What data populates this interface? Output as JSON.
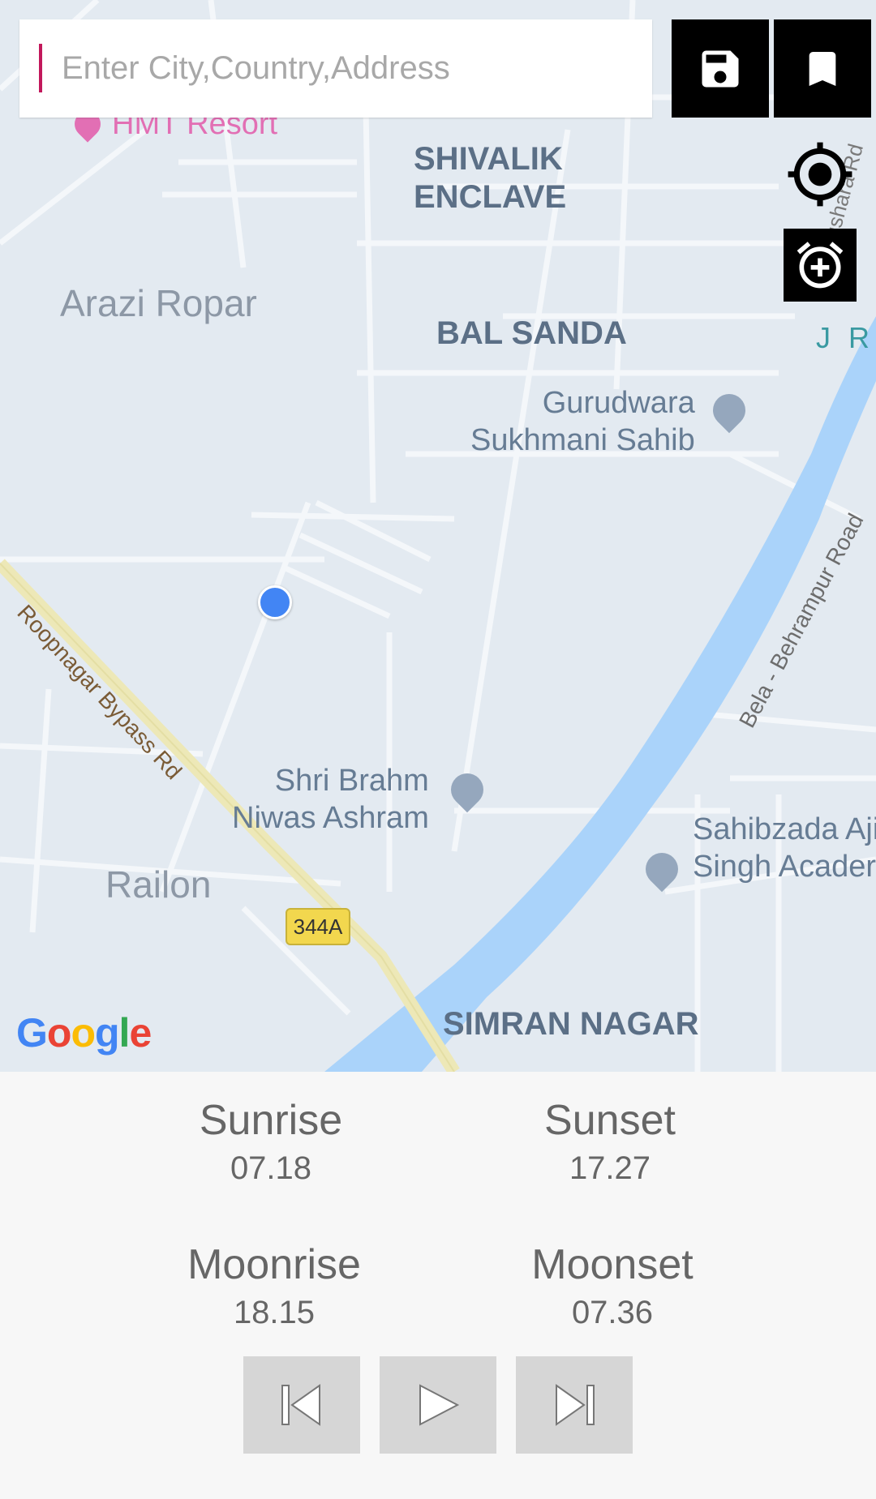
{
  "search": {
    "placeholder": "Enter City,Country,Address",
    "value": ""
  },
  "toolbar": {
    "save_icon": "save-icon",
    "bookmark_icon": "bookmark-icon",
    "locate_icon": "my-location-icon",
    "alarm_icon": "add-alarm-icon"
  },
  "map": {
    "labels": {
      "hmt_resort": "HMT Resort",
      "shivalik_1": "SHIVALIK",
      "shivalik_2": "ENCLAVE",
      "arazi_ropar": "Arazi Ropar",
      "bal_sanda": "BAL SANDA",
      "jr": "J R T",
      "gurudwara_1": "Gurudwara",
      "gurudwara_2": "Sukhmani Sahib",
      "roopnagar_bypass": "Roopnagar Bypass Rd",
      "bela_behrampur": "Bela - Behrampur Road",
      "ushara_rd": "ushara Rd",
      "shri_brahm_1": "Shri Brahm",
      "shri_brahm_2": "Niwas Ashram",
      "sahibzada_1": "Sahibzada Aji",
      "sahibzada_2": "Singh Acader",
      "railon": "Railon",
      "highway_shield": "344A",
      "simran_nagar": "SIMRAN NAGAR"
    },
    "attribution": "Google",
    "colors": {
      "water": "#aad3fa",
      "highway": "#ede8b7",
      "road": "#f4f7fa",
      "land": "#e3eaf1",
      "location_dot": "#4285f4"
    }
  },
  "info": {
    "sunrise": {
      "label": "Sunrise",
      "value": "07.18"
    },
    "sunset": {
      "label": "Sunset",
      "value": "17.27"
    },
    "moonrise": {
      "label": "Moonrise",
      "value": "18.15"
    },
    "moonset": {
      "label": "Moonset",
      "value": "07.36"
    }
  },
  "controls": {
    "previous_icon": "skip-previous-icon",
    "play_icon": "play-icon",
    "next_icon": "skip-next-icon"
  }
}
